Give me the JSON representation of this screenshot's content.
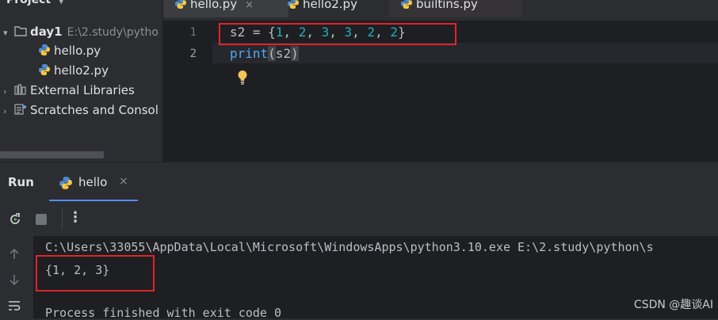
{
  "project": {
    "header": "Project",
    "tree": [
      {
        "label": "day1",
        "detail": "E:\\2.study\\pytho",
        "type": "folder"
      },
      {
        "label": "hello.py",
        "type": "python-file"
      },
      {
        "label": "hello2.py",
        "type": "python-file"
      },
      {
        "label": "External Libraries",
        "type": "library"
      },
      {
        "label": "Scratches and Consol",
        "type": "scratches"
      }
    ]
  },
  "editor_tabs": [
    {
      "label": "hello.py",
      "close": "×"
    },
    {
      "label": "hello2.py"
    },
    {
      "label": "builtins.py"
    }
  ],
  "editor": {
    "line_numbers": [
      "1",
      "2"
    ],
    "line1": {
      "var": "s2",
      "op": " = {",
      "nums": [
        "1",
        "2",
        "3",
        "3",
        "2",
        "2"
      ],
      "end": "}"
    },
    "line2": {
      "fn": "print",
      "open": "(",
      "arg": "s2",
      "close": ")"
    }
  },
  "run": {
    "label": "Run",
    "tab_label": "hello",
    "tab_close": "×"
  },
  "console": {
    "command": "C:\\Users\\33055\\AppData\\Local\\Microsoft\\WindowsApps\\python3.10.exe E:\\2.study\\python\\s",
    "output": "{1, 2, 3}",
    "finish": "Process finished with exit code 0"
  },
  "watermark": "CSDN @趣谈AI",
  "colors": {
    "highlight_box": "#e0242a",
    "number": "#2aacb8",
    "function": "#56a8f5",
    "accent": "#548af7"
  }
}
